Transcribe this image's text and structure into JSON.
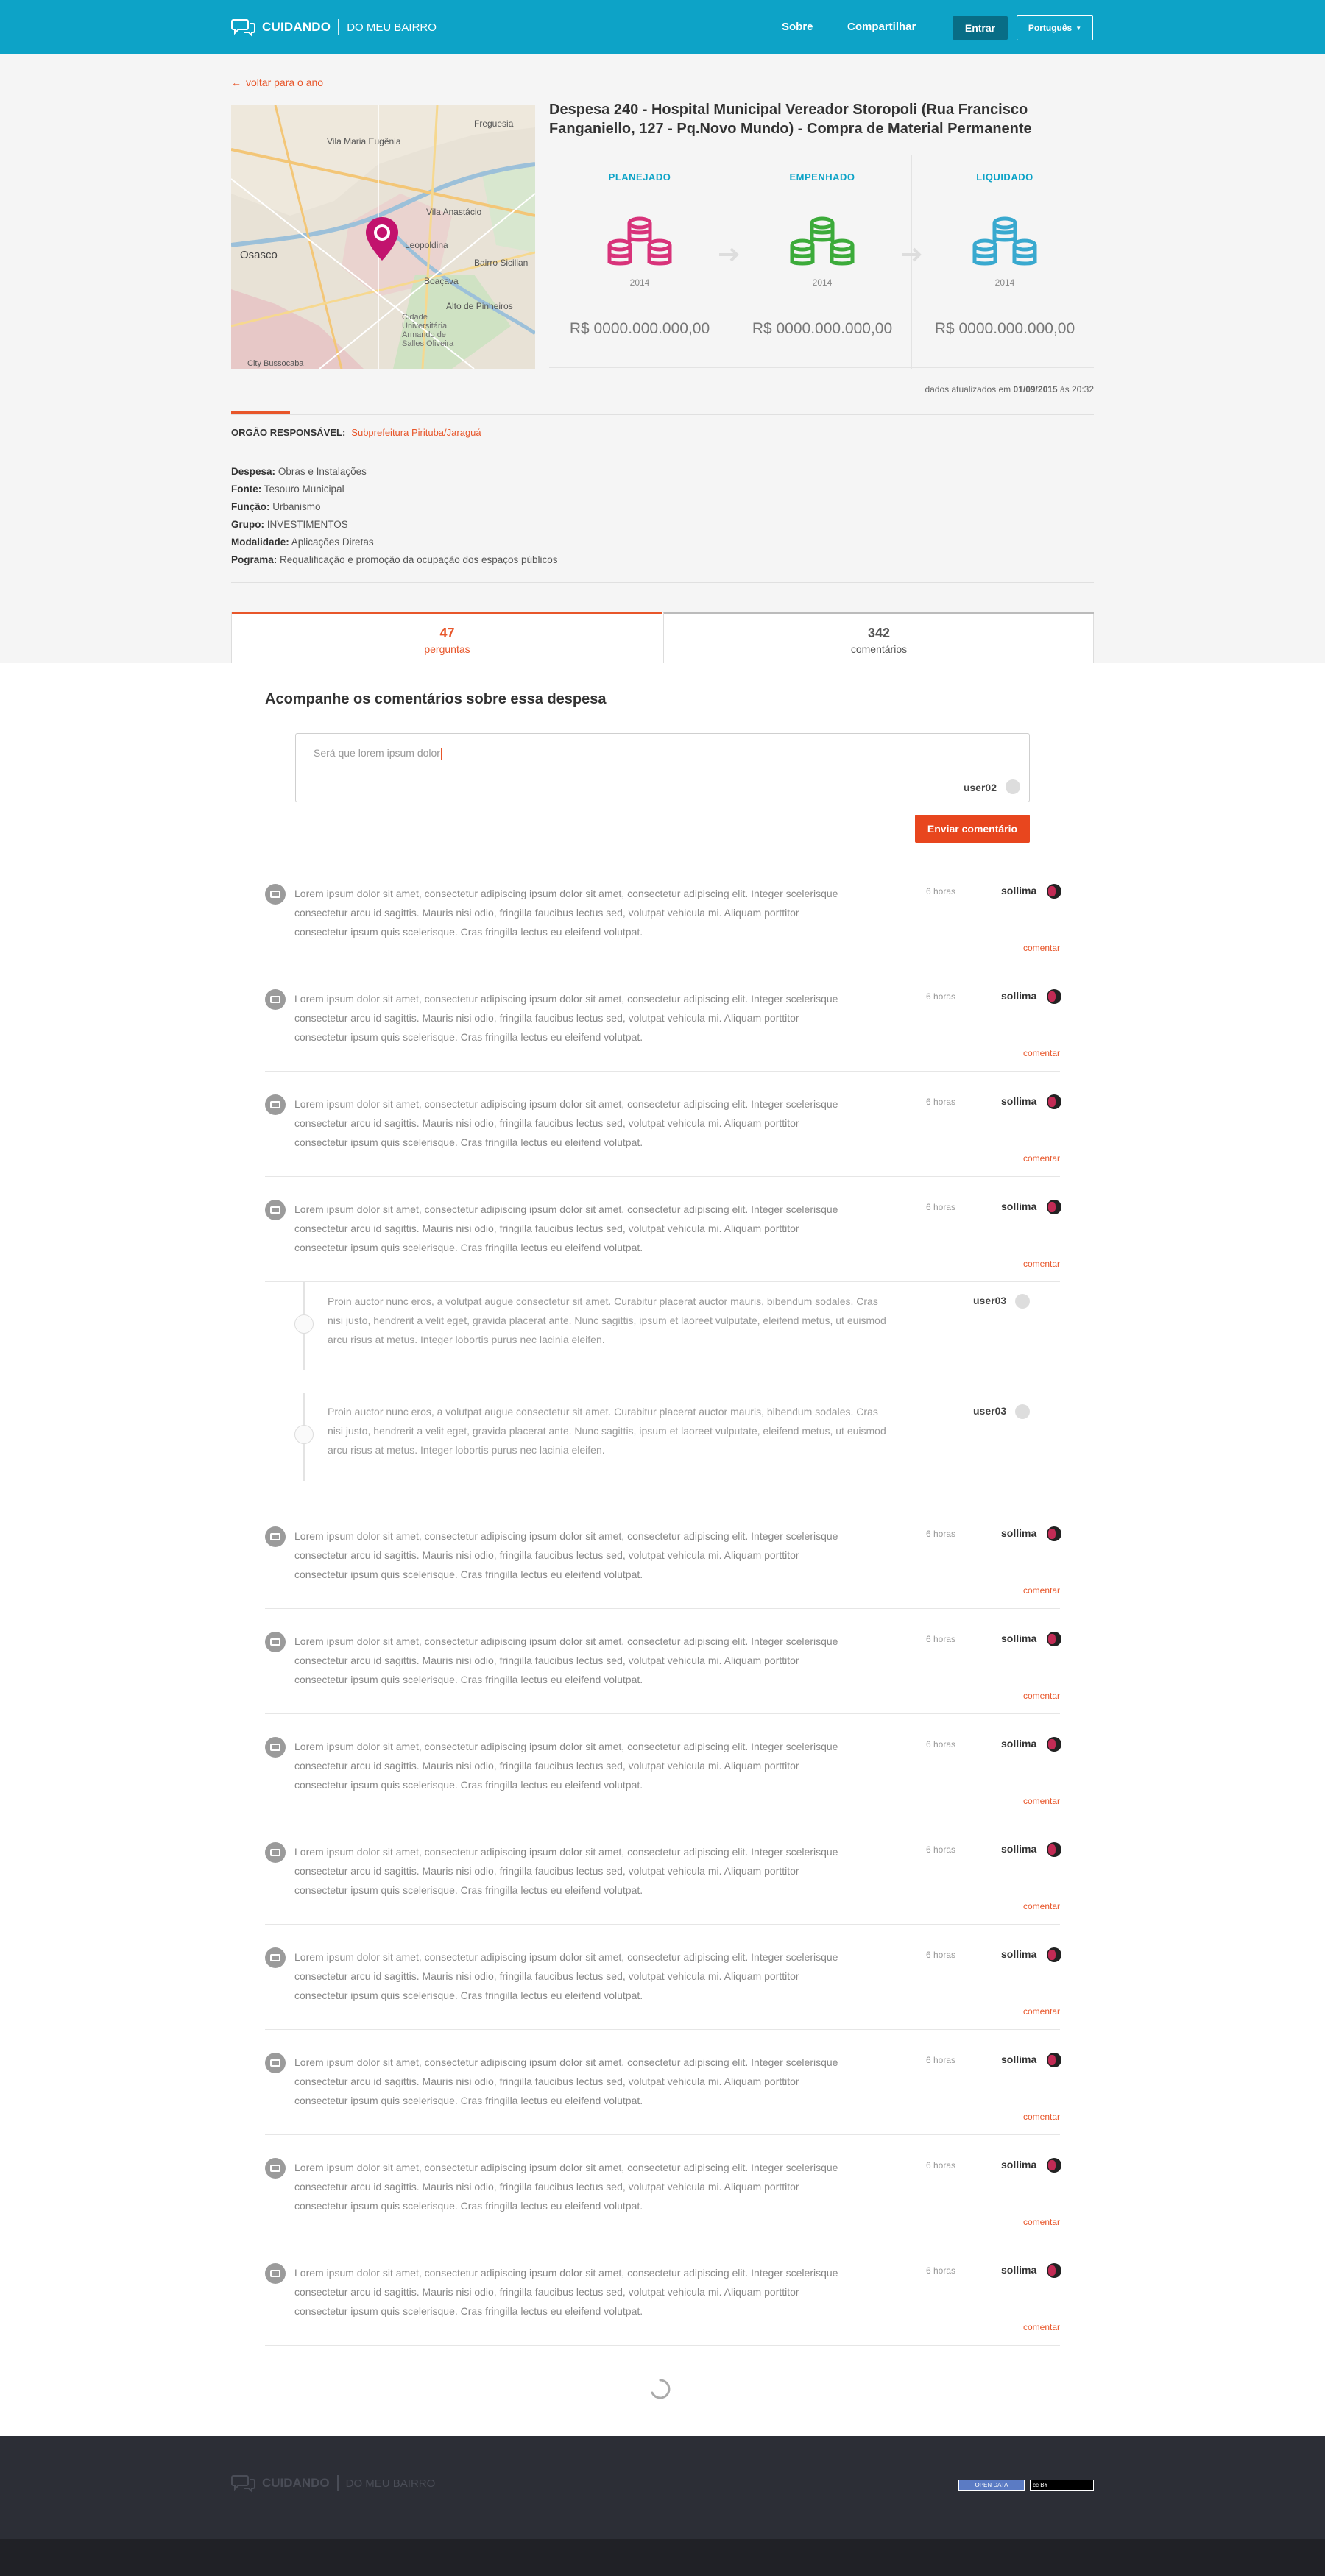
{
  "header": {
    "brand": "CUIDANDO",
    "brand_sub": "DO MEU BAIRRO",
    "nav": [
      "Sobre",
      "Compartilhar"
    ],
    "login": "Entrar",
    "language": "Português"
  },
  "back_link": "voltar para o ano",
  "expense": {
    "title": "Despesa 240 - Hospital Municipal Vereador Storopoli (Rua Francisco Fanganiello, 127 - Pq.Novo Mundo) - Compra de Material Permanente",
    "stages": [
      {
        "label": "PLANEJADO",
        "year": "2014",
        "value": "R$ 0000.000.000,00",
        "color": "#d8337a"
      },
      {
        "label": "EMPENHADO",
        "year": "2014",
        "value": "R$ 0000.000.000,00",
        "color": "#3cab3a"
      },
      {
        "label": "LIQUIDADO",
        "year": "2014",
        "value": "R$ 0000.000.000,00",
        "color": "#39a9cf"
      }
    ],
    "updated_prefix": "dados atualizados em",
    "updated_date": "01/09/2015",
    "updated_mid": "às",
    "updated_time": "20:32"
  },
  "map": {
    "labels": [
      "Freguesia",
      "Vila Maria Eugênia",
      "Vila Anastácio",
      "Osasco",
      "Leopoldina",
      "Bairro Sicilian",
      "Boaçava",
      "Alto de Pinheiros",
      "Cidade Universitária Armando de Salles Oliveira",
      "City Bussocaba"
    ]
  },
  "orgao": {
    "label": "ORGÃO RESPONSÁVEL:",
    "value": "Subprefeitura Pirituba/Jaraguá"
  },
  "details": [
    {
      "key": "Despesa:",
      "value": "Obras e Instalações"
    },
    {
      "key": "Fonte:",
      "value": "Tesouro Municipal"
    },
    {
      "key": "Função:",
      "value": "Urbanismo"
    },
    {
      "key": "Grupo:",
      "value": "INVESTIMENTOS"
    },
    {
      "key": "Modalidade:",
      "value": "Aplicações Diretas"
    },
    {
      "key": "Pograma:",
      "value": "Requalificação e promoção da ocupação dos espaços públicos"
    }
  ],
  "tabs": [
    {
      "count": "47",
      "label": "perguntas"
    },
    {
      "count": "342",
      "label": "comentários"
    }
  ],
  "comments_section": {
    "heading": "Acompanhe os comentários sobre essa despesa",
    "placeholder": "Será que lorem ipsum dolor",
    "current_user": "user02",
    "send_button": "Enviar comentário"
  },
  "comment_template": {
    "text": "Lorem ipsum dolor sit amet, consectetur adipiscing ipsum dolor sit amet, consectetur adipiscing elit. Integer scelerisque consectetur arcu id sagittis. Mauris nisi odio, fringilla faucibus lectus sed, volutpat vehicula mi. Aliquam porttitor consectetur ipsum quis scelerisque. Cras fringilla lectus eu eleifend volutpat.",
    "time": "6 horas",
    "user": "sollima",
    "reply": "comentar"
  },
  "comments": [
    {
      "text": "Lorem ipsum dolor sit amet, consectetur adipiscing ipsum dolor sit amet, consectetur adipiscing elit. Integer scelerisque consectetur arcu id sagittis. Mauris nisi odio, fringilla faucibus lectus sed, volutpat vehicula mi. Aliquam porttitor consectetur ipsum quis scelerisque. Cras fringilla lectus eu eleifend volutpat.",
      "time": "6 horas",
      "user": "sollima",
      "reply": "comentar"
    },
    {
      "text": "Lorem ipsum dolor sit amet, consectetur adipiscing ipsum dolor sit amet, consectetur adipiscing elit. Integer scelerisque consectetur arcu id sagittis. Mauris nisi odio, fringilla faucibus lectus sed, volutpat vehicula mi. Aliquam porttitor consectetur ipsum quis scelerisque. Cras fringilla lectus eu eleifend volutpat.",
      "time": "6 horas",
      "user": "sollima",
      "reply": "comentar"
    },
    {
      "text": "Lorem ipsum dolor sit amet, consectetur adipiscing ipsum dolor sit amet, consectetur adipiscing elit. Integer scelerisque consectetur arcu id sagittis. Mauris nisi odio, fringilla faucibus lectus sed, volutpat vehicula mi. Aliquam porttitor consectetur ipsum quis scelerisque. Cras fringilla lectus eu eleifend volutpat.",
      "time": "6 horas",
      "user": "sollima",
      "reply": "comentar"
    },
    {
      "text": "Lorem ipsum dolor sit amet, consectetur adipiscing ipsum dolor sit amet, consectetur adipiscing elit. Integer scelerisque consectetur arcu id sagittis. Mauris nisi odio, fringilla faucibus lectus sed, volutpat vehicula mi. Aliquam porttitor consectetur ipsum quis scelerisque. Cras fringilla lectus eu eleifend volutpat.",
      "time": "6 horas",
      "user": "sollima",
      "reply": "comentar"
    },
    {
      "text": "Lorem ipsum dolor sit amet, consectetur adipiscing ipsum dolor sit amet, consectetur adipiscing elit. Integer scelerisque consectetur arcu id sagittis. Mauris nisi odio, fringilla faucibus lectus sed, volutpat vehicula mi. Aliquam porttitor consectetur ipsum quis scelerisque. Cras fringilla lectus eu eleifend volutpat.",
      "time": "6 horas",
      "user": "sollima",
      "reply": "comentar"
    },
    {
      "text": "Lorem ipsum dolor sit amet, consectetur adipiscing ipsum dolor sit amet, consectetur adipiscing elit. Integer scelerisque consectetur arcu id sagittis. Mauris nisi odio, fringilla faucibus lectus sed, volutpat vehicula mi. Aliquam porttitor consectetur ipsum quis scelerisque. Cras fringilla lectus eu eleifend volutpat.",
      "time": "6 horas",
      "user": "sollima",
      "reply": "comentar"
    },
    {
      "text": "Lorem ipsum dolor sit amet, consectetur adipiscing ipsum dolor sit amet, consectetur adipiscing elit. Integer scelerisque consectetur arcu id sagittis. Mauris nisi odio, fringilla faucibus lectus sed, volutpat vehicula mi. Aliquam porttitor consectetur ipsum quis scelerisque. Cras fringilla lectus eu eleifend volutpat.",
      "time": "6 horas",
      "user": "sollima",
      "reply": "comentar"
    },
    {
      "text": "Lorem ipsum dolor sit amet, consectetur adipiscing ipsum dolor sit amet, consectetur adipiscing elit. Integer scelerisque consectetur arcu id sagittis. Mauris nisi odio, fringilla faucibus lectus sed, volutpat vehicula mi. Aliquam porttitor consectetur ipsum quis scelerisque. Cras fringilla lectus eu eleifend volutpat.",
      "time": "6 horas",
      "user": "sollima",
      "reply": "comentar"
    },
    {
      "text": "Lorem ipsum dolor sit amet, consectetur adipiscing ipsum dolor sit amet, consectetur adipiscing elit. Integer scelerisque consectetur arcu id sagittis. Mauris nisi odio, fringilla faucibus lectus sed, volutpat vehicula mi. Aliquam porttitor consectetur ipsum quis scelerisque. Cras fringilla lectus eu eleifend volutpat.",
      "time": "6 horas",
      "user": "sollima",
      "reply": "comentar"
    },
    {
      "text": "Lorem ipsum dolor sit amet, consectetur adipiscing ipsum dolor sit amet, consectetur adipiscing elit. Integer scelerisque consectetur arcu id sagittis. Mauris nisi odio, fringilla faucibus lectus sed, volutpat vehicula mi. Aliquam porttitor consectetur ipsum quis scelerisque. Cras fringilla lectus eu eleifend volutpat.",
      "time": "6 horas",
      "user": "sollima",
      "reply": "comentar"
    },
    {
      "text": "Lorem ipsum dolor sit amet, consectetur adipiscing ipsum dolor sit amet, consectetur adipiscing elit. Integer scelerisque consectetur arcu id sagittis. Mauris nisi odio, fringilla faucibus lectus sed, volutpat vehicula mi. Aliquam porttitor consectetur ipsum quis scelerisque. Cras fringilla lectus eu eleifend volutpat.",
      "time": "6 horas",
      "user": "sollima",
      "reply": "comentar"
    },
    {
      "text": "Lorem ipsum dolor sit amet, consectetur adipiscing ipsum dolor sit amet, consectetur adipiscing elit. Integer scelerisque consectetur arcu id sagittis. Mauris nisi odio, fringilla faucibus lectus sed, volutpat vehicula mi. Aliquam porttitor consectetur ipsum quis scelerisque. Cras fringilla lectus eu eleifend volutpat.",
      "time": "6 horas",
      "user": "sollima",
      "reply": "comentar"
    }
  ],
  "replies": [
    {
      "text": "Proin auctor nunc eros, a volutpat augue consectetur sit amet. Curabitur placerat auctor mauris, bibendum sodales. Cras nisi justo, hendrerit a velit eget, gravida placerat ante. Nunc sagittis, ipsum et laoreet vulputate, eleifend metus, ut euismod arcu risus at metus. Integer lobortis purus nec lacinia eleifen.",
      "user": "user03"
    },
    {
      "text": "Proin auctor nunc eros, a volutpat augue consectetur sit amet. Curabitur placerat auctor mauris, bibendum sodales. Cras nisi justo, hendrerit a velit eget, gravida placerat ante. Nunc sagittis, ipsum et laoreet vulputate, eleifend metus, ut euismod arcu risus at metus. Integer lobortis purus nec lacinia eleifen.",
      "user": "user03"
    }
  ],
  "footer": {
    "brand": "CUIDANDO",
    "brand_sub": "DO MEU BAIRRO",
    "badge_open": "OPEN DATA",
    "badge_cc": "cc BY"
  },
  "colors": {
    "header": "#0da3c7",
    "accent": "#e8562a",
    "footer": "#2c2e36"
  }
}
